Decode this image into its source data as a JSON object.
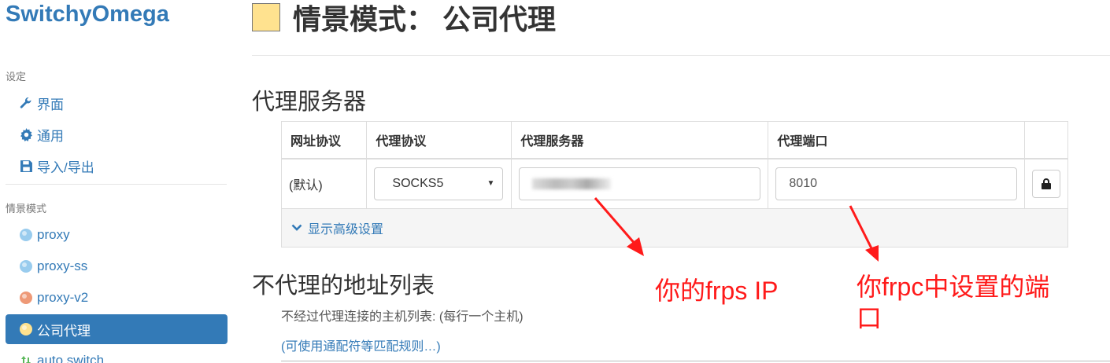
{
  "app": {
    "title": "SwitchyOmega"
  },
  "sidebar": {
    "settings_header": "设定",
    "settings_items": [
      {
        "label": "界面",
        "icon": "wrench-icon"
      },
      {
        "label": "通用",
        "icon": "gear-icon"
      },
      {
        "label": "导入/导出",
        "icon": "floppy-icon"
      }
    ],
    "profiles_header": "情景模式",
    "profile_items": [
      {
        "label": "proxy",
        "color": "#99ccee",
        "active": false
      },
      {
        "label": "proxy-ss",
        "color": "#99ccee",
        "active": false
      },
      {
        "label": "proxy-v2",
        "color": "#ee9977",
        "active": false
      },
      {
        "label": "公司代理",
        "color": "#ffe28f",
        "active": true
      },
      {
        "label": "auto switch",
        "icon": "switch-icon",
        "active": false
      }
    ]
  },
  "main": {
    "title": "情景模式： 公司代理",
    "profile_color": "#ffe28f",
    "proxy_section_title": "代理服务器",
    "table": {
      "headers": [
        "网址协议",
        "代理协议",
        "代理服务器",
        "代理端口"
      ],
      "row": {
        "scheme": "(默认)",
        "protocol": "SOCKS5",
        "server": "",
        "port": "8010"
      },
      "advanced_label": "显示高级设置"
    },
    "bypass_section_title": "不代理的地址列表",
    "bypass_note": "不经过代理连接的主机列表: (每行一个主机)",
    "bypass_link": "(可使用通配符等匹配规则…)"
  },
  "annotations": {
    "server_note": "你的frps IP",
    "port_note": "你frpc中设置的端口"
  },
  "colors": {
    "accent": "#337ab7",
    "annotation": "#ff1a1a"
  }
}
